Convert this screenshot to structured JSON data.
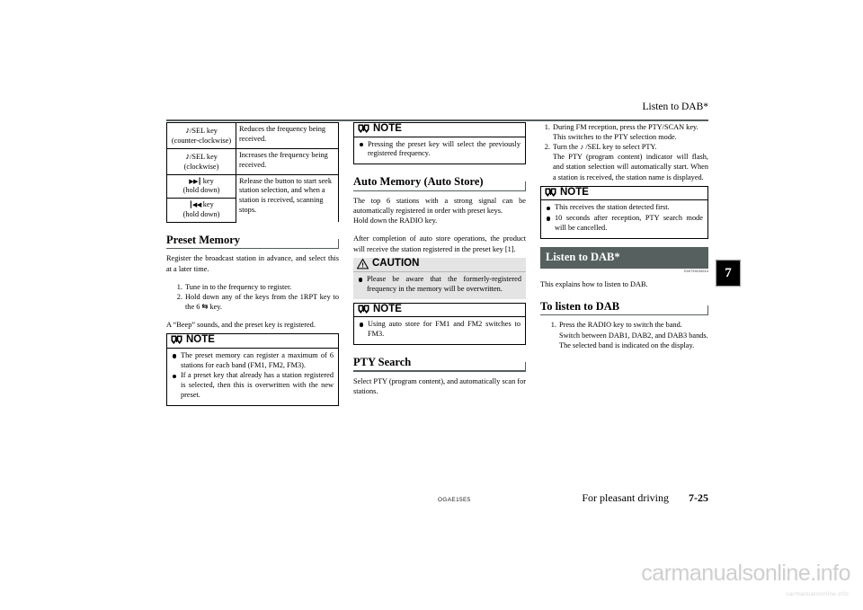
{
  "header": {
    "title": "Listen to DAB*"
  },
  "chapter_tab": "7",
  "footer": {
    "code": "OGAE15E5",
    "section": "For pleasant driving",
    "page": "7-25"
  },
  "watermark": {
    "main": "carmanualsonline.info",
    "sub": "carmanualsonline.info"
  },
  "column1": {
    "key_table": {
      "rows": [
        {
          "key": "/SEL key",
          "key_sym": "note-icon",
          "key_sub": "(counter-clockwise)",
          "desc": "Reduces the frequency being received."
        },
        {
          "key": "/SEL key",
          "key_sym": "note-icon",
          "key_sub": "(clockwise)",
          "desc": "Increases the frequency being received."
        },
        {
          "key": "key",
          "key_sym": "fast-forward-icon",
          "key_sub": "(hold down)",
          "desc": "Release the button to start seek station selection, and when a station is received, scanning stops."
        },
        {
          "key": "key",
          "key_sym": "rewind-icon",
          "key_sub": "(hold down)",
          "desc": ""
        }
      ]
    },
    "preset_memory": {
      "heading": "Preset Memory",
      "intro": "Register the broadcast station in advance, and select this at a later time.",
      "steps": [
        "Tune in to the frequency to register.",
        "Hold down any of the keys from the 1RPT key to the 6 ⇆ key."
      ],
      "after": "A “Beep” sounds, and the preset key is registered."
    },
    "note": {
      "title": "NOTE",
      "bullets": [
        "The preset memory can register a maximum of 6 stations for each band (FM1, FM2, FM3).",
        "If a preset key that already has a station registered is selected, then this is overwritten with the new preset."
      ]
    }
  },
  "column2": {
    "note_top": {
      "title": "NOTE",
      "bullets": [
        "Pressing the preset key will select the previously registered frequency."
      ]
    },
    "auto_memory": {
      "heading": "Auto Memory (Auto Store)",
      "para1": "The top 6 stations with a strong signal can be automatically registered in order with preset keys.",
      "para2": "Hold down the RADIO key.",
      "para3": "After completion of auto store operations, the product will receive the station registered in the preset key [1]."
    },
    "caution": {
      "title": "CAUTION",
      "bullets": [
        "Please be aware that the formerly-registered frequency in the memory will be overwritten."
      ]
    },
    "note_bottom": {
      "title": "NOTE",
      "bullets": [
        "Using auto store for FM1 and FM2 switches to FM3."
      ]
    },
    "pty_search": {
      "heading": "PTY Search",
      "para1": "Select PTY (program content), and automatically scan for stations."
    }
  },
  "column3": {
    "pty_steps": [
      {
        "main": "During FM reception, press the PTY/SCAN key.",
        "subs": [
          "This switches to the PTY selection mode."
        ]
      },
      {
        "main": "Turn the ♪ /SEL key to select PTY.",
        "subs": [
          "The PTY (program content) indicator will flash, and station selection will automatically start. When a station is received, the station name is displayed."
        ]
      }
    ],
    "note": {
      "title": "NOTE",
      "bullets": [
        "This receives the station detected first.",
        "10 seconds after reception, PTY search mode will be cancelled."
      ]
    },
    "banner": {
      "heading": "Listen to DAB*",
      "code": "E00739100014"
    },
    "intro": "This explains how to listen to DAB.",
    "to_listen": {
      "heading": "To listen to DAB",
      "steps": [
        {
          "main": "Press the RADIO key to switch the band.",
          "subs": [
            "Switch between DAB1, DAB2, and DAB3 bands.",
            "The selected band is indicated on the display."
          ]
        }
      ]
    }
  }
}
